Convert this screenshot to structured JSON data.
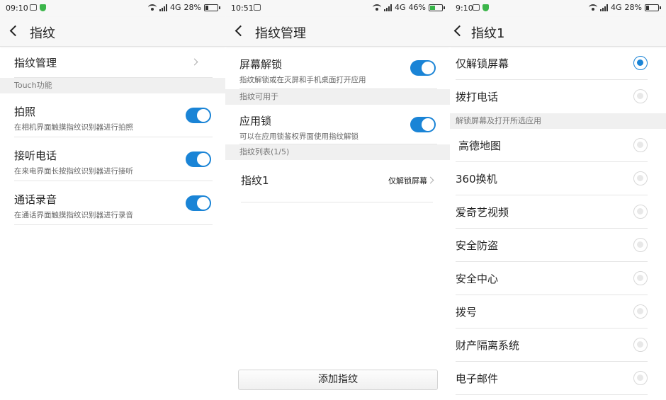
{
  "colors": {
    "accent": "#1a84d6",
    "section_bg": "#f0f0f0"
  },
  "screen1": {
    "status": {
      "time": "09:10",
      "network": "4G",
      "battery": "28%",
      "battery_fraction": 0.28
    },
    "title": "指纹",
    "manage_label": "指纹管理",
    "section_touch": "Touch功能",
    "items": [
      {
        "title": "拍照",
        "desc": "在相机界面触摸指纹识别器进行拍照",
        "on": true
      },
      {
        "title": "接听电话",
        "desc": "在来电界面长按指纹识别器进行接听",
        "on": true
      },
      {
        "title": "通话录音",
        "desc": "在通话界面触摸指纹识别器进行录音",
        "on": true
      }
    ]
  },
  "screen2": {
    "status": {
      "time": "10:51",
      "network": "4G",
      "battery": "46%",
      "battery_fraction": 0.46
    },
    "title": "指纹管理",
    "screen_unlock": {
      "title": "屏幕解锁",
      "desc": "指纹解锁或在灭屏和手机桌面打开应用",
      "on": true
    },
    "section_usable": "指纹可用于",
    "app_lock": {
      "title": "应用锁",
      "desc": "可以在应用锁鉴权界面使用指纹解锁",
      "on": true
    },
    "section_list": "指纹列表(1/5)",
    "fingerprint": {
      "name": "指纹1",
      "value": "仅解锁屏幕"
    },
    "add_button": "添加指纹"
  },
  "screen3": {
    "status": {
      "time": "9:10",
      "network": "4G",
      "battery": "28%",
      "battery_fraction": 0.28
    },
    "title": "指纹1",
    "options": [
      {
        "label": "仅解锁屏幕",
        "selected": true
      },
      {
        "label": "拨打电话",
        "selected": false
      }
    ],
    "section_apps": "解锁屏幕及打开所选应用",
    "apps": [
      {
        "label": "高德地图"
      },
      {
        "label": "360换机"
      },
      {
        "label": "爱奇艺视频"
      },
      {
        "label": "安全防盗"
      },
      {
        "label": "安全中心"
      },
      {
        "label": "拨号"
      },
      {
        "label": "财产隔离系统"
      },
      {
        "label": "电子邮件"
      }
    ]
  }
}
